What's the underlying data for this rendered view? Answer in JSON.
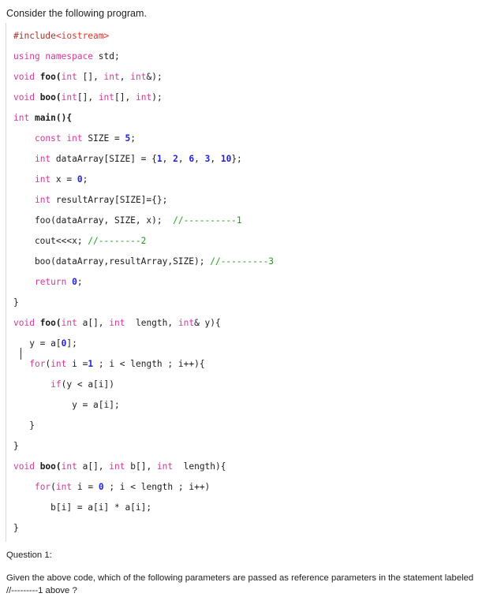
{
  "intro": {
    "text": "Consider the following program."
  },
  "code": {
    "language": "cpp",
    "colors": {
      "keyword": "#d4399b",
      "number": "#2222dd",
      "comment": "#1a9e1a",
      "preprocessor": "#a8342a",
      "include_header": "#e0352b",
      "plain": "#1c1c1c",
      "border": "#d9d9d9"
    },
    "lines": [
      {
        "segments": [
          {
            "t": "#include",
            "c": "pre"
          },
          {
            "t": "<iostream>",
            "c": "inc"
          }
        ]
      },
      {
        "segments": [
          {
            "t": "using namespace ",
            "c": "kw"
          },
          {
            "t": "std;",
            "c": "pl"
          }
        ]
      },
      {
        "segments": [
          {
            "t": "void ",
            "c": "kw"
          },
          {
            "t": "foo(",
            "c": "fn"
          },
          {
            "t": "int",
            "c": "kw"
          },
          {
            "t": " [], ",
            "c": "pl"
          },
          {
            "t": "int",
            "c": "kw"
          },
          {
            "t": ", ",
            "c": "pl"
          },
          {
            "t": "int",
            "c": "kw"
          },
          {
            "t": "&);",
            "c": "pl"
          }
        ]
      },
      {
        "segments": [
          {
            "t": "void ",
            "c": "kw"
          },
          {
            "t": "boo(",
            "c": "fn"
          },
          {
            "t": "int",
            "c": "kw"
          },
          {
            "t": "[], ",
            "c": "pl"
          },
          {
            "t": "int",
            "c": "kw"
          },
          {
            "t": "[], ",
            "c": "pl"
          },
          {
            "t": "int",
            "c": "kw"
          },
          {
            "t": ");",
            "c": "pl"
          }
        ]
      },
      {
        "segments": [
          {
            "t": "int ",
            "c": "kw"
          },
          {
            "t": "main(){",
            "c": "fn"
          }
        ]
      },
      {
        "segments": [
          {
            "t": "    ",
            "c": "pl"
          },
          {
            "t": "const int ",
            "c": "kw"
          },
          {
            "t": "SIZE = ",
            "c": "pl"
          },
          {
            "t": "5",
            "c": "num"
          },
          {
            "t": ";",
            "c": "pl"
          }
        ]
      },
      {
        "segments": [
          {
            "t": "    ",
            "c": "pl"
          },
          {
            "t": "int ",
            "c": "kw"
          },
          {
            "t": "dataArray[SIZE] = {",
            "c": "pl"
          },
          {
            "t": "1",
            "c": "num"
          },
          {
            "t": ", ",
            "c": "pl"
          },
          {
            "t": "2",
            "c": "num"
          },
          {
            "t": ", ",
            "c": "pl"
          },
          {
            "t": "6",
            "c": "num"
          },
          {
            "t": ", ",
            "c": "pl"
          },
          {
            "t": "3",
            "c": "num"
          },
          {
            "t": ", ",
            "c": "pl"
          },
          {
            "t": "10",
            "c": "num"
          },
          {
            "t": "};",
            "c": "pl"
          }
        ]
      },
      {
        "segments": [
          {
            "t": "    ",
            "c": "pl"
          },
          {
            "t": "int ",
            "c": "kw"
          },
          {
            "t": "x = ",
            "c": "pl"
          },
          {
            "t": "0",
            "c": "num"
          },
          {
            "t": ";",
            "c": "pl"
          }
        ]
      },
      {
        "segments": [
          {
            "t": "    ",
            "c": "pl"
          },
          {
            "t": "int ",
            "c": "kw"
          },
          {
            "t": "resultArray[SIZE]={};",
            "c": "pl"
          }
        ]
      },
      {
        "segments": [
          {
            "t": "    foo(dataArray, SIZE, x);  ",
            "c": "pl"
          },
          {
            "t": "//----------1",
            "c": "cmt"
          }
        ]
      },
      {
        "segments": [
          {
            "t": "    cout<<<x; ",
            "c": "pl"
          },
          {
            "t": "//--------2",
            "c": "cmt"
          }
        ]
      },
      {
        "segments": [
          {
            "t": "    boo(dataArray,resultArray,SIZE); ",
            "c": "pl"
          },
          {
            "t": "//---------3",
            "c": "cmt"
          }
        ]
      },
      {
        "segments": [
          {
            "t": "    ",
            "c": "pl"
          },
          {
            "t": "return ",
            "c": "kw"
          },
          {
            "t": "0",
            "c": "num"
          },
          {
            "t": ";",
            "c": "pl"
          }
        ]
      },
      {
        "segments": [
          {
            "t": "}",
            "c": "pl"
          }
        ]
      },
      {
        "segments": [
          {
            "t": "void ",
            "c": "kw"
          },
          {
            "t": "foo(",
            "c": "fn"
          },
          {
            "t": "int",
            "c": "kw"
          },
          {
            "t": " a[], ",
            "c": "pl"
          },
          {
            "t": "int",
            "c": "kw"
          },
          {
            "t": "  length, ",
            "c": "pl"
          },
          {
            "t": "int",
            "c": "kw"
          },
          {
            "t": "& y){",
            "c": "pl"
          }
        ]
      },
      {
        "caret": true,
        "segments": [
          {
            "t": "   y = a[",
            "c": "pl"
          },
          {
            "t": "0",
            "c": "num"
          },
          {
            "t": "];",
            "c": "pl"
          }
        ]
      },
      {
        "segments": [
          {
            "t": "   ",
            "c": "pl"
          },
          {
            "t": "for",
            "c": "kw"
          },
          {
            "t": "(",
            "c": "pl"
          },
          {
            "t": "int",
            "c": "kw"
          },
          {
            "t": " i =",
            "c": "pl"
          },
          {
            "t": "1",
            "c": "num"
          },
          {
            "t": " ; i < length ; i++){",
            "c": "pl"
          }
        ]
      },
      {
        "segments": [
          {
            "t": "       ",
            "c": "pl"
          },
          {
            "t": "if",
            "c": "kw"
          },
          {
            "t": "(y < a[i])",
            "c": "pl"
          }
        ]
      },
      {
        "segments": [
          {
            "t": "           y = a[i];",
            "c": "pl"
          }
        ]
      },
      {
        "segments": [
          {
            "t": "   }",
            "c": "pl"
          }
        ]
      },
      {
        "segments": [
          {
            "t": "}",
            "c": "pl"
          }
        ]
      },
      {
        "segments": [
          {
            "t": "void ",
            "c": "kw"
          },
          {
            "t": "boo(",
            "c": "fn"
          },
          {
            "t": "int",
            "c": "kw"
          },
          {
            "t": " a[], ",
            "c": "pl"
          },
          {
            "t": "int",
            "c": "kw"
          },
          {
            "t": " b[], ",
            "c": "pl"
          },
          {
            "t": "int",
            "c": "kw"
          },
          {
            "t": "  length){",
            "c": "pl"
          }
        ]
      },
      {
        "segments": [
          {
            "t": "    ",
            "c": "pl"
          },
          {
            "t": "for",
            "c": "kw"
          },
          {
            "t": "(",
            "c": "pl"
          },
          {
            "t": "int",
            "c": "kw"
          },
          {
            "t": " i = ",
            "c": "pl"
          },
          {
            "t": "0",
            "c": "num"
          },
          {
            "t": " ; i < length ; i++)",
            "c": "pl"
          }
        ]
      },
      {
        "segments": [
          {
            "t": "       b[i] = a[i] * a[i];",
            "c": "pl"
          }
        ]
      },
      {
        "segments": [
          {
            "t": "}",
            "c": "pl"
          }
        ]
      }
    ]
  },
  "question": {
    "label": "Question 1:",
    "text": "Given the above code, which of the following parameters are passed as reference parameters in the statement labeled //---------1 above ?"
  }
}
